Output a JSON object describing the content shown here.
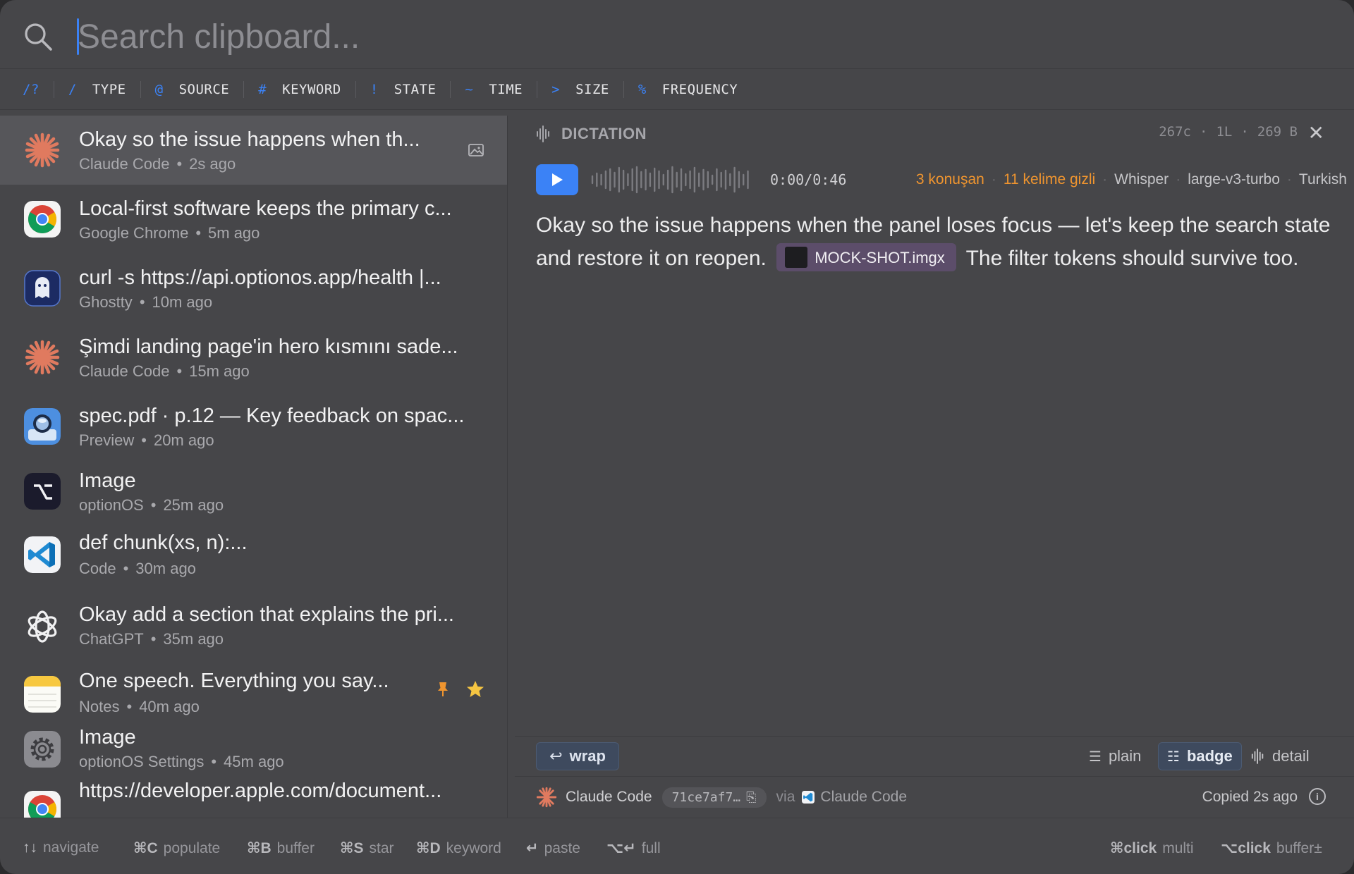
{
  "search": {
    "placeholder": "Search clipboard..."
  },
  "filters": {
    "help": "/?",
    "tokens": [
      {
        "sym": "/",
        "label": "TYPE"
      },
      {
        "sym": "@",
        "label": "SOURCE"
      },
      {
        "sym": "#",
        "label": "KEYWORD"
      },
      {
        "sym": "!",
        "label": "STATE"
      },
      {
        "sym": "~",
        "label": "TIME"
      },
      {
        "sym": ">",
        "label": "SIZE"
      },
      {
        "sym": "%",
        "label": "FREQUENCY"
      }
    ]
  },
  "items": [
    {
      "title": "Okay so the issue happens when th...",
      "app": "Claude Code",
      "time": "2s ago",
      "icon": "claude-icon"
    },
    {
      "title": "Local-first software keeps the primary c...",
      "app": "Google Chrome",
      "time": "5m ago",
      "icon": "chrome-icon"
    },
    {
      "title": "curl -s https://api.optionos.app/health |...",
      "app": "Ghostty",
      "time": "10m ago",
      "icon": "ghostty-icon"
    },
    {
      "title": "Şimdi landing page'in hero kısmını sade...",
      "app": "Claude Code",
      "time": "15m ago",
      "icon": "claude-icon"
    },
    {
      "title": "spec.pdf · p.12 — Key feedback on spac...",
      "app": "Preview",
      "time": "20m ago",
      "icon": "preview-icon"
    },
    {
      "title": "Image",
      "app": "optionOS",
      "time": "25m ago",
      "icon": "optionos-icon"
    },
    {
      "title": "def chunk(xs, n):...",
      "app": "Code",
      "time": "30m ago",
      "icon": "vscode-icon"
    },
    {
      "title": "Okay add a section that explains the pri...",
      "app": "ChatGPT",
      "time": "35m ago",
      "icon": "chatgpt-icon"
    },
    {
      "title": "One speech. Everything you say...",
      "app": "Notes",
      "time": "40m ago",
      "icon": "notes-icon",
      "pinned": true,
      "starred": true
    },
    {
      "title": "Image",
      "app": "optionOS Settings",
      "time": "45m ago",
      "icon": "settings-icon"
    },
    {
      "title": "https://developer.apple.com/document...",
      "app": "",
      "time": "",
      "icon": "chrome-icon"
    }
  ],
  "detail": {
    "kind": "DICTATION",
    "stats": {
      "chars": "267c",
      "lines": "1L",
      "bytes": "269 B"
    },
    "time": "0:00/0:46",
    "speakers": "3 konuşan",
    "hidden_words": "11 kelime gizli",
    "engine": "Whisper",
    "model": "large-v3-turbo",
    "language": "Turkish",
    "text_before": "Okay so the issue happens when the panel loses focus — let's keep the search state and restore it on reopen.",
    "chip": "MOCK-SHOT.imgx",
    "text_after": "The filter tokens should survive too.",
    "wrap_label": "wrap",
    "modes": {
      "plain": "plain",
      "badge": "badge",
      "detail": "detail"
    },
    "footer": {
      "app": "Claude Code",
      "hash": "71ce7af7…",
      "via": "via",
      "via_app": "Claude Code",
      "copied": "Copied 2s ago"
    }
  },
  "hints": [
    {
      "key": "↑↓",
      "label": "navigate"
    },
    {
      "key": "⌘C",
      "label": "populate"
    },
    {
      "key": "⌘B",
      "label": "buffer"
    },
    {
      "key": "⌘S",
      "label": "star"
    },
    {
      "key": "⌘D",
      "label": "keyword"
    },
    {
      "key": "↵",
      "label": "paste"
    },
    {
      "key": "⌥↵",
      "label": "full"
    },
    {
      "key": "⌘click",
      "label": "multi"
    },
    {
      "key": "⌥click",
      "label": "buffer±"
    }
  ],
  "colors": {
    "accent": "#3b82f6",
    "warning": "#f0952f",
    "claude": "#e07a5f"
  }
}
